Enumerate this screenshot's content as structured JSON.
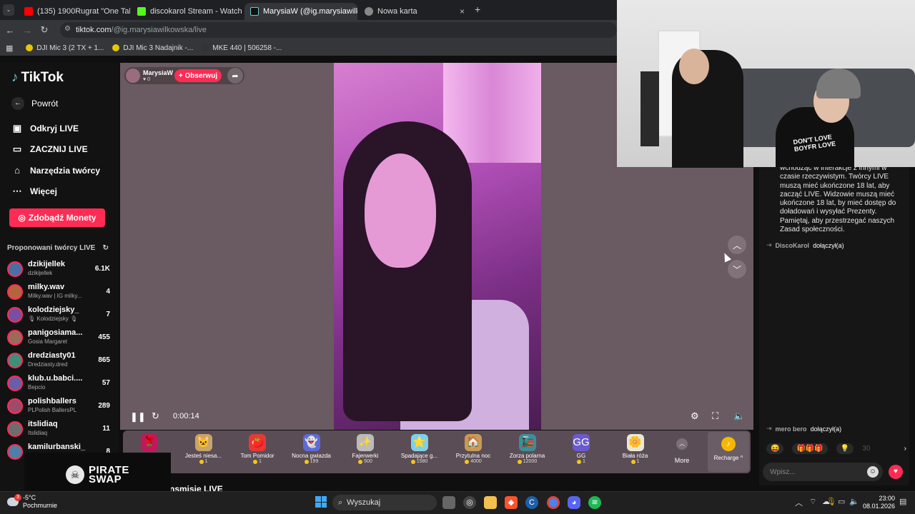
{
  "browser": {
    "tabs": [
      {
        "title": "(135) 1900Rugrat \"One Take Fre",
        "close": "×"
      },
      {
        "title": "discokarol Stream - Watch Live",
        "close": "×"
      },
      {
        "title": "MarysiaW (@ig.marysiawilk",
        "close": "×"
      },
      {
        "title": "Nowa karta",
        "close": "×"
      }
    ],
    "new_tab": "+",
    "url_host": "tiktok.com",
    "url_path": "/@ig.marysiawilkowska/live",
    "bookmarks": [
      "DJI Mic 3 (2 TX + 1...",
      "DJI Mic 3 Nadajnik -...",
      "MKE 440 | 506258 -..."
    ]
  },
  "sidebar": {
    "logo": "TikTok",
    "back": "Powrót",
    "nav": [
      {
        "label": "Odkryj LIVE",
        "icon": "live-calendar-icon"
      },
      {
        "label": "ZACZNIJ LIVE",
        "icon": "camera-icon"
      },
      {
        "label": "Narzędzia twórcy",
        "icon": "home-bulb-icon"
      },
      {
        "label": "Więcej",
        "icon": "more-dots-icon"
      }
    ],
    "coins_button": "Zdobądź Monety",
    "suggested_title": "Proponowani twórcy LIVE",
    "creators": [
      {
        "name": "dzikijellek",
        "sub": "dzikijellek",
        "count": "6.1K"
      },
      {
        "name": "milky.wav",
        "sub": "Milky.wav | IG milky...",
        "count": "4"
      },
      {
        "name": "kolodziejsky_",
        "sub": "🎙 Kolodziejsky 🎙",
        "count": "7"
      },
      {
        "name": "panigosiama...",
        "sub": "Gosia Margaret",
        "count": "455"
      },
      {
        "name": "dredziasty01",
        "sub": "Dredziasty.dred",
        "count": "865"
      },
      {
        "name": "klub.u.babci....",
        "sub": "Bepcio",
        "count": "57"
      },
      {
        "name": "polishballers",
        "sub": "PLPolish BallersPL",
        "count": "289"
      },
      {
        "name": "itslidiaq",
        "sub": "Itslidiaq",
        "count": "11"
      },
      {
        "name": "kamilurbanski_",
        "sub": "",
        "count": "8"
      }
    ]
  },
  "stream": {
    "host_name": "MarysiaW",
    "host_likes": "0",
    "follow_label": "+ Obserwuj",
    "timer": "0:00:14",
    "below_title": "nsmisie LIVE"
  },
  "gifts": [
    {
      "name": "",
      "price": "",
      "emoji": "🌹",
      "color": "#c2185b"
    },
    {
      "name": "Jesteś niesa...",
      "price": "1",
      "emoji": "🐱",
      "color": "#c9a46b"
    },
    {
      "name": "Tom Pomidor",
      "price": "1",
      "emoji": "🍅",
      "color": "#e53935"
    },
    {
      "name": "Nocna gwiazda",
      "price": "199",
      "emoji": "👻",
      "color": "#5e6bd6"
    },
    {
      "name": "Fajerwerki",
      "price": "500",
      "emoji": "✨",
      "color": "#bbbbbb"
    },
    {
      "name": "Spadające g...",
      "price": "1580",
      "emoji": "⭐",
      "color": "#7fd0e8"
    },
    {
      "name": "Przytulna noc",
      "price": "4000",
      "emoji": "🏠",
      "color": "#c99a56"
    },
    {
      "name": "Zorza polarna",
      "price": "12000",
      "emoji": "🚂",
      "color": "#3a8f9a"
    },
    {
      "name": "GG",
      "price": "1",
      "emoji": "GG",
      "color": "#6a5acd"
    },
    {
      "name": "Biała róża",
      "price": "1",
      "emoji": "🌼",
      "color": "#e8e8d8"
    }
  ],
  "more_label": "More",
  "recharge_label": "Recharge ^",
  "chat": {
    "notice": "wchodząc w interakcje z innymi w czasie rzeczywistym. Twórcy LIVE muszą mieć ukończone 18 lat, aby zacząć LIVE. Widzowie muszą mieć ukończone 18 lat, by mieć dostęp do doładowań i wysyłać Prezenty. Pamiętaj, aby przestrzegać naszych Zasad społeczności.",
    "joins": [
      {
        "user": "DiscoKarol",
        "action": "dołączył(a)"
      },
      {
        "user": "mero bero",
        "action": "dołączył(a)"
      }
    ],
    "input_placeholder": "Wpisz..."
  },
  "overlay": {
    "shirt_text": "DON'T LOVE BOYFR LOVE",
    "brand_line1": "PIRATE",
    "brand_line2": "SWAP"
  },
  "taskbar": {
    "weather_temp": "-5°C",
    "weather_desc": "Pochmurnie",
    "weather_badge": "3",
    "search": "Wyszukaj",
    "time": "23:00",
    "date": "08.01.2026"
  }
}
